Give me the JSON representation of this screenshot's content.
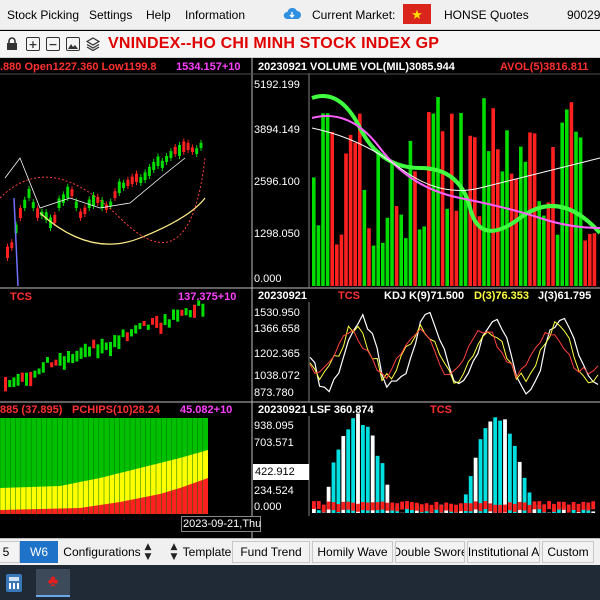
{
  "menu": {
    "items": [
      "Stock Picking",
      "Settings",
      "Help",
      "Information"
    ],
    "current_market_label": "Current Market:",
    "quotes_label": "HONSE Quotes",
    "account_number": "90029"
  },
  "toolbar": {
    "title": "VNINDEX--HO CHI MINH STOCK INDEX  GP",
    "icons": [
      "lock-icon",
      "add-icon",
      "remove-icon",
      "image-icon",
      "layers-icon"
    ]
  },
  "panels": {
    "price": {
      "header_left": ".880 Open1227.360 Low1199.8",
      "header_right": "1534.157+10",
      "footer_code": "TCS",
      "colors": {
        "up": "#00dd00",
        "down": "#ff2020",
        "ma": "#ffee88"
      }
    },
    "volume": {
      "header": "20230921 VOLUME VOL(MIL)3085.944",
      "header_avol": "AVOL(5)3816.811",
      "y_labels": [
        "5192.199",
        "3894.149",
        "2596.100",
        "1298.050",
        "0.000"
      ]
    },
    "tcs": {
      "header_right": "137.375+10"
    },
    "kdj": {
      "header_date": "20230921",
      "header_code": "TCS",
      "header_k": "KDJ  K(9)71.500",
      "header_d": "D(3)76.353",
      "header_j": "J(3)61.795",
      "y_labels": [
        "1530.950",
        "1366.658",
        "1202.365",
        "1038.072",
        "873.780"
      ]
    },
    "pchips": {
      "header_left": "885 (37.895)",
      "header_mid": "PCHIPS(10)28.24",
      "header_right": "45.082+10"
    },
    "lsf": {
      "header": "20230921 LSF 360.874",
      "header_code": "TCS",
      "y_labels": [
        "938.095",
        "703.571",
        "234.524",
        "0.000"
      ],
      "cursor_value": "422.912"
    },
    "cursor_date": "2023-09-21,Thu"
  },
  "tabs": {
    "items": [
      "5",
      "W6",
      "Configurations",
      "Template",
      "Fund Trend",
      "Homily Wave",
      "Double Swore",
      "Institutional A",
      "Custom"
    ],
    "active": "W6"
  },
  "taskbar": {
    "icons": [
      "calculator-icon",
      "stock-app-icon"
    ],
    "app_symbol": "♣"
  }
}
